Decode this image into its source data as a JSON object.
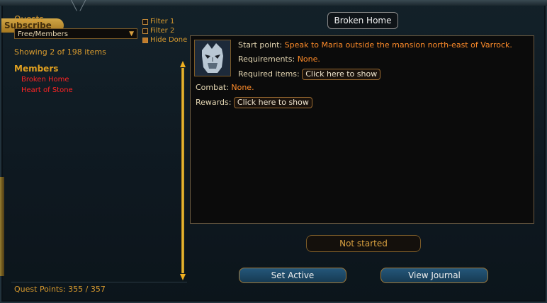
{
  "left": {
    "panel_title": "Quests",
    "subscribe_label": "Subscribe",
    "dropdown_value": "Free/Members",
    "filters": [
      {
        "label": "Filter 1",
        "checked": false
      },
      {
        "label": "Filter 2",
        "checked": false
      },
      {
        "label": "Hide Done",
        "checked": true
      }
    ],
    "showing_text": "Showing 2 of 198 items",
    "group_title": "Members",
    "quests": [
      "Broken Home",
      "Heart of Stone"
    ],
    "quest_points": "Quest Points: 355 / 357"
  },
  "detail": {
    "title": "Broken Home",
    "start_point_label": "Start point:",
    "start_point_value": "Speak to Maria outside the mansion north-east of Varrock.",
    "requirements_label": "Requirements:",
    "requirements_value": "None.",
    "required_items_label": "Required items:",
    "show_button_label": "Click here to show",
    "combat_label": "Combat:",
    "combat_value": "None.",
    "rewards_label": "Rewards:",
    "status": "Not started"
  },
  "buttons": {
    "set_active": "Set Active",
    "view_journal": "View Journal"
  },
  "colors": {
    "accent_orange": "#d89a2e",
    "quest_red": "#ff2424",
    "value_orange": "#ff8c2a"
  }
}
